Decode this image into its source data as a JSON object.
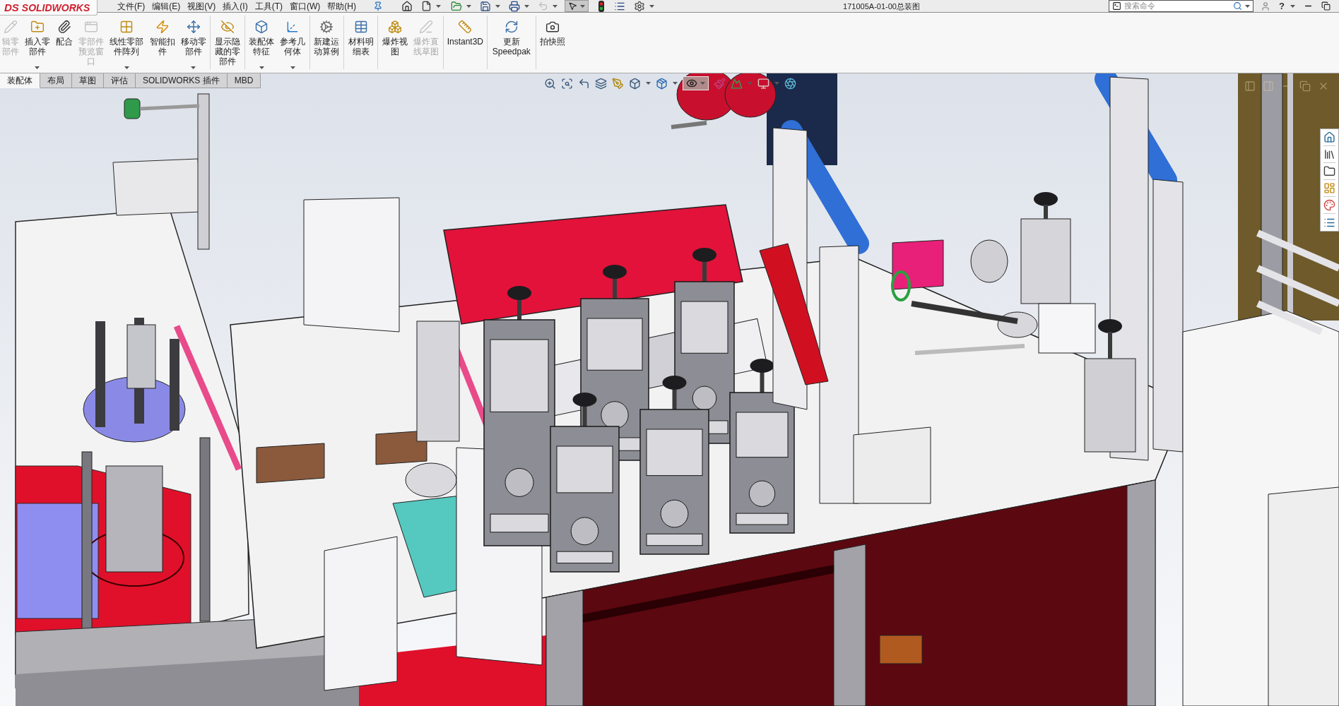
{
  "app": {
    "logo_mark": "DS",
    "logo_name": "SOLIDWORKS"
  },
  "menu": [
    "文件(F)",
    "编辑(E)",
    "视图(V)",
    "插入(I)",
    "工具(T)",
    "窗口(W)",
    "帮助(H)"
  ],
  "quick_access": {
    "undo": {
      "disabled": true
    },
    "select": {
      "selected": true
    }
  },
  "window": {
    "title": "171005A-01-00总装图"
  },
  "search": {
    "placeholder": "搜索命令"
  },
  "help": "?",
  "command_manager": {
    "groups": [
      [
        {
          "label": "辑零部件",
          "disabled": true,
          "dropdown": false
        },
        {
          "label": "插入零部件",
          "disabled": false,
          "dropdown": true
        },
        {
          "label": "配合",
          "disabled": false,
          "dropdown": false
        },
        {
          "label": "零部件预览窗口",
          "disabled": true,
          "dropdown": false
        },
        {
          "label": "线性零部件阵列",
          "disabled": false,
          "dropdown": true
        },
        {
          "label": "智能扣件",
          "disabled": false,
          "dropdown": false
        },
        {
          "label": "移动零部件",
          "disabled": false,
          "dropdown": true
        }
      ],
      [
        {
          "label": "显示隐藏的零部件",
          "disabled": false,
          "dropdown": false
        }
      ],
      [
        {
          "label": "装配体特征",
          "disabled": false,
          "dropdown": true
        },
        {
          "label": "参考几何体",
          "disabled": false,
          "dropdown": true
        }
      ],
      [
        {
          "label": "新建运动算例",
          "disabled": false,
          "dropdown": false
        }
      ],
      [
        {
          "label": "材料明细表",
          "disabled": false,
          "dropdown": false
        }
      ],
      [
        {
          "label": "爆炸视图",
          "disabled": false,
          "dropdown": false
        },
        {
          "label": "爆炸直线草图",
          "disabled": true,
          "dropdown": false
        }
      ],
      [
        {
          "label": "Instant3D",
          "disabled": false,
          "dropdown": false
        }
      ],
      [
        {
          "label": "更新 Speedpak",
          "disabled": false,
          "dropdown": false
        }
      ],
      [
        {
          "label": "拍快照",
          "disabled": false,
          "dropdown": false
        }
      ]
    ]
  },
  "tabs": [
    {
      "label": "装配体",
      "selected": true
    },
    {
      "label": "布局",
      "selected": false
    },
    {
      "label": "草图",
      "selected": false
    },
    {
      "label": "评估",
      "selected": false
    },
    {
      "label": "SOLIDWORKS 插件",
      "selected": false
    },
    {
      "label": "MBD",
      "selected": false
    }
  ],
  "view_toolbar": {
    "hide_show": {
      "selected": true
    }
  }
}
